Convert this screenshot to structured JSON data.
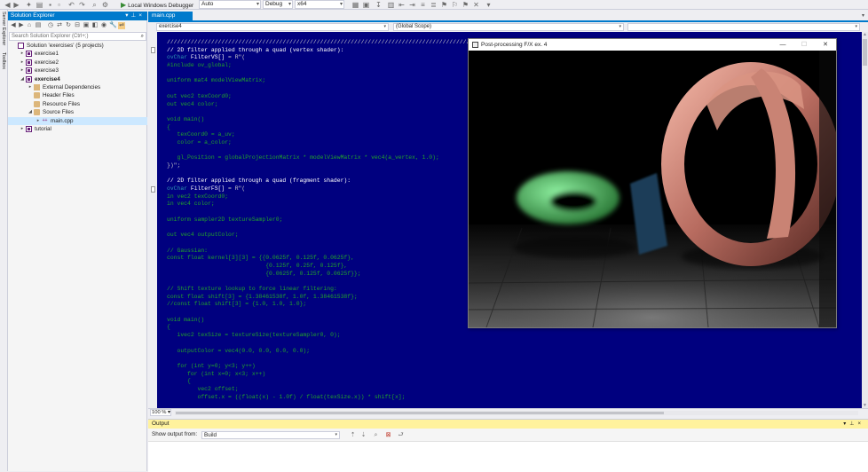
{
  "toolbar": {
    "run_label": "Local Windows Debugger",
    "run_config": "Auto",
    "build_config": "Debug",
    "platform": "x64"
  },
  "side_strip": {
    "server_explorer": "Server Explorer",
    "toolbox": "Toolbox"
  },
  "solution_explorer": {
    "title": "Solution Explorer",
    "search_placeholder": "Search Solution Explorer (Ctrl+;)",
    "items": [
      {
        "label": "Solution 'exercises' (5 projects)",
        "level": 0,
        "icon": "solution-icon",
        "expander": ""
      },
      {
        "label": "exercise1",
        "level": 1,
        "icon": "project-icon",
        "expander": "▸"
      },
      {
        "label": "exercise2",
        "level": 1,
        "icon": "project-icon",
        "expander": "▸"
      },
      {
        "label": "exercise3",
        "level": 1,
        "icon": "project-icon",
        "expander": "▸"
      },
      {
        "label": "exercise4",
        "level": 1,
        "icon": "project-icon",
        "expander": "◢",
        "bold": true
      },
      {
        "label": "External Dependencies",
        "level": 2,
        "icon": "external-deps-icon",
        "expander": "▸"
      },
      {
        "label": "Header Files",
        "level": 2,
        "icon": "folder-icon",
        "expander": ""
      },
      {
        "label": "Resource Files",
        "level": 2,
        "icon": "folder-icon",
        "expander": ""
      },
      {
        "label": "Source Files",
        "level": 2,
        "icon": "folder-icon",
        "expander": "◢"
      },
      {
        "label": "main.cpp",
        "level": 3,
        "icon": "cpp-file-icon",
        "expander": "▸",
        "selected": true
      },
      {
        "label": "tutorial",
        "level": 1,
        "icon": "project-icon",
        "expander": "▸"
      }
    ]
  },
  "editor": {
    "tab_label": "main.cpp",
    "project_combo": "exercise4",
    "scope_combo": "(Global Scope)",
    "zoom": "100 %",
    "code_lines": [
      [
        {
          "t": "//////////////////////////////////////////////////////////////////////////////////////////////////////",
          "c": "wh"
        }
      ],
      [
        {
          "t": "// 2D filter applied through a quad (vertex shader):",
          "c": "hl"
        }
      ],
      [
        {
          "t": "ovChar ",
          "c": "kw"
        },
        {
          "t": "FilterVS[]",
          "c": "hl"
        },
        {
          "t": " = R\"(",
          "c": "wh"
        }
      ],
      [
        {
          "t": "#include ov_global;",
          "c": "gn"
        }
      ],
      [
        {
          "t": "",
          "c": "gn"
        }
      ],
      [
        {
          "t": "uniform mat4 modelViewMatrix;",
          "c": "gn"
        }
      ],
      [
        {
          "t": "",
          "c": "gn"
        }
      ],
      [
        {
          "t": "out vec2 texCoord0;",
          "c": "gn"
        }
      ],
      [
        {
          "t": "out vec4 color;",
          "c": "gn"
        }
      ],
      [
        {
          "t": "",
          "c": "gn"
        }
      ],
      [
        {
          "t": "void main()",
          "c": "gn"
        }
      ],
      [
        {
          "t": "{",
          "c": "gn"
        }
      ],
      [
        {
          "t": "   texCoord0 = a_uv;",
          "c": "gn"
        }
      ],
      [
        {
          "t": "   color = a_color;",
          "c": "gn"
        }
      ],
      [
        {
          "t": "",
          "c": "gn"
        }
      ],
      [
        {
          "t": "   gl_Position = globalProjectionMatrix * modelViewMatrix * vec4(a_vertex, 1.0);",
          "c": "gn"
        }
      ],
      [
        {
          "t": "})\";",
          "c": "wh"
        }
      ],
      [
        {
          "t": "",
          "c": "gn"
        }
      ],
      [
        {
          "t": "// 2D filter applied through a quad (fragment shader):",
          "c": "hl"
        }
      ],
      [
        {
          "t": "ovChar ",
          "c": "kw"
        },
        {
          "t": "FilterFS[]",
          "c": "hl"
        },
        {
          "t": " = R\"(",
          "c": "wh"
        }
      ],
      [
        {
          "t": "in vec2 texCoord0;",
          "c": "gn"
        }
      ],
      [
        {
          "t": "in vec4 color;",
          "c": "gn"
        }
      ],
      [
        {
          "t": "",
          "c": "gn"
        }
      ],
      [
        {
          "t": "uniform sampler2D textureSampler0;",
          "c": "gn"
        }
      ],
      [
        {
          "t": "",
          "c": "gn"
        }
      ],
      [
        {
          "t": "out vec4 outputColor;",
          "c": "gn"
        }
      ],
      [
        {
          "t": "",
          "c": "gn"
        }
      ],
      [
        {
          "t": "// Gaussian:",
          "c": "gn"
        }
      ],
      [
        {
          "t": "const float kernel[3][3] = {{0.0625f, 0.125f, 0.0625f},",
          "c": "gn"
        }
      ],
      [
        {
          "t": "                             {0.125f, 0.25f, 0.125f},",
          "c": "gn"
        }
      ],
      [
        {
          "t": "                             {0.0625f, 0.125f, 0.0625f}};",
          "c": "gn"
        }
      ],
      [
        {
          "t": "",
          "c": "gn"
        }
      ],
      [
        {
          "t": "// Shift texture lookup to force linear filtering:",
          "c": "gn"
        }
      ],
      [
        {
          "t": "const float shift[3] = {1.38461538f, 1.0f, 1.38461538f};",
          "c": "gn"
        }
      ],
      [
        {
          "t": "//const float shift[3] = {1.0, 1.0, 1.0};",
          "c": "gn"
        }
      ],
      [
        {
          "t": "",
          "c": "gn"
        }
      ],
      [
        {
          "t": "void main()",
          "c": "gn"
        }
      ],
      [
        {
          "t": "{",
          "c": "gn"
        }
      ],
      [
        {
          "t": "   ivec2 texSize = textureSize(textureSampler0, 0);",
          "c": "gn"
        }
      ],
      [
        {
          "t": "",
          "c": "gn"
        }
      ],
      [
        {
          "t": "   outputColor = vec4(0.0, 0.0, 0.0, 0.0);",
          "c": "gn"
        }
      ],
      [
        {
          "t": "",
          "c": "gn"
        }
      ],
      [
        {
          "t": "   for (int y=0; y<3; y++)",
          "c": "gn"
        }
      ],
      [
        {
          "t": "      for (int x=0; x<3; x++)",
          "c": "gn"
        }
      ],
      [
        {
          "t": "      {",
          "c": "gn"
        }
      ],
      [
        {
          "t": "         vec2 offset;",
          "c": "gn"
        }
      ],
      [
        {
          "t": "         offset.x = ((float(x) - 1.0f) / float(texSize.x)) * shift[x];",
          "c": "gn"
        }
      ]
    ]
  },
  "gl_window": {
    "title": "Post-processing F/X ex. 4"
  },
  "output": {
    "title": "Output",
    "show_from_label": "Show output from:",
    "source": "Build"
  },
  "colors": {
    "accent": "#007acc",
    "editor_bg": "#00007f",
    "output_title_bg": "#fff29d"
  }
}
